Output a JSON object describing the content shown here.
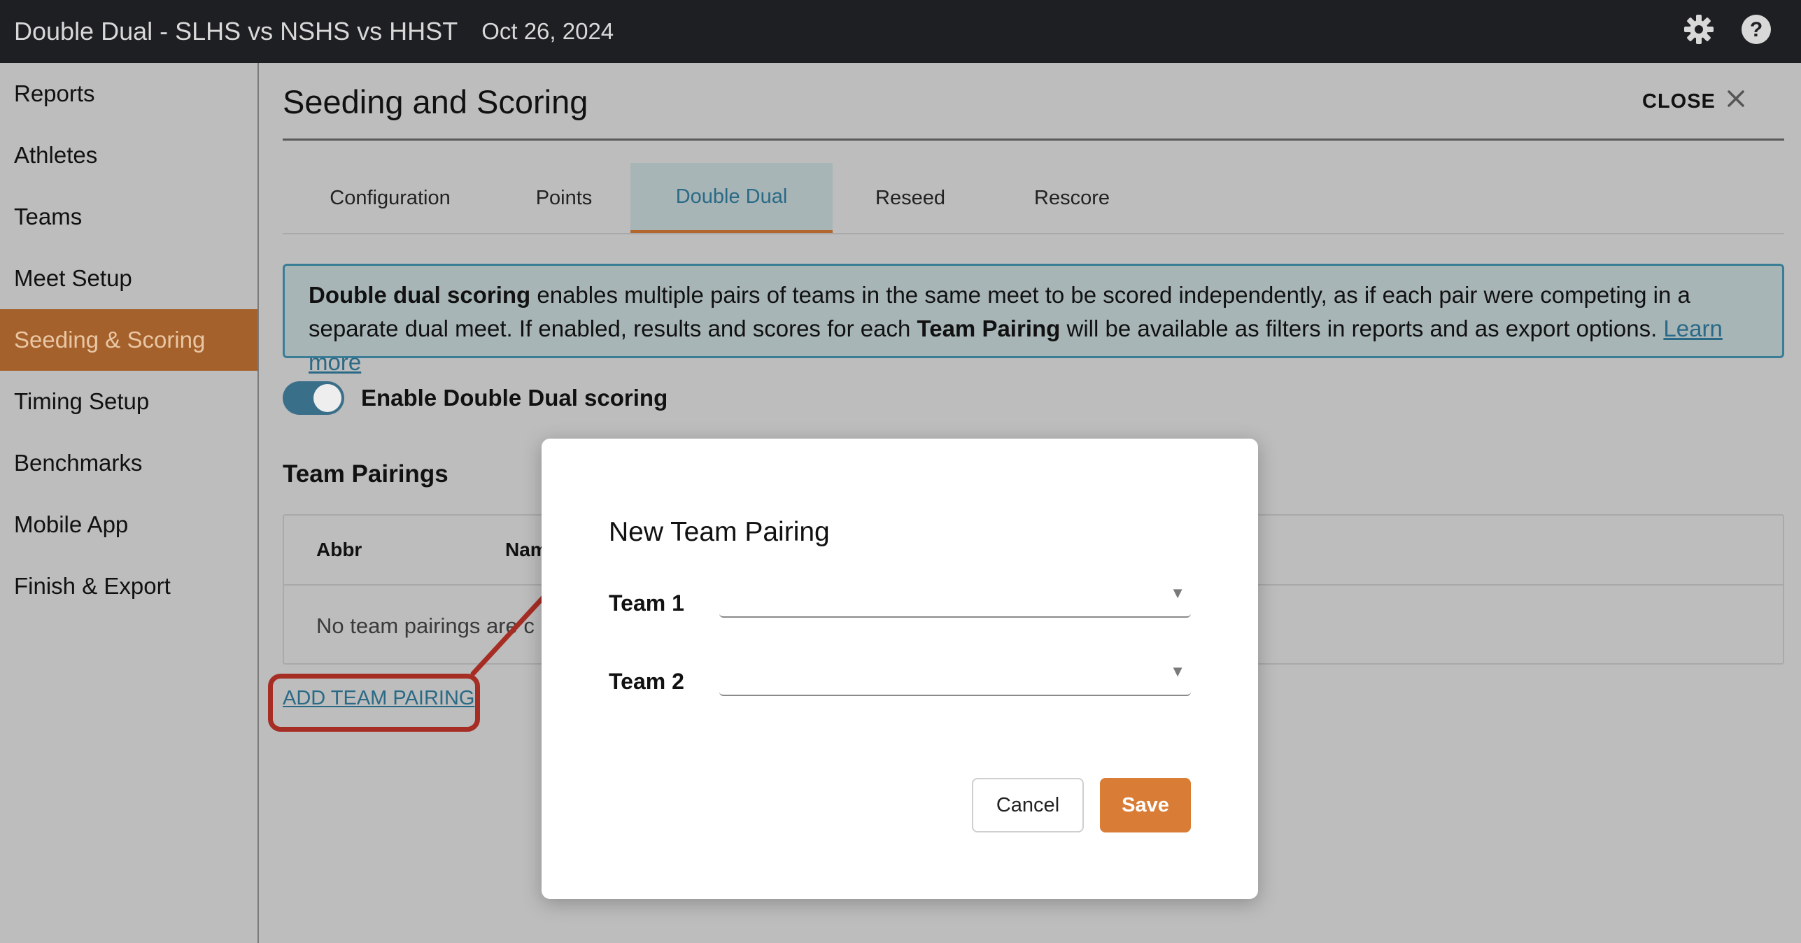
{
  "header": {
    "title": "Double Dual - SLHS vs NSHS vs HHST",
    "date": "Oct 26, 2024",
    "icons": [
      "gear-icon",
      "help-icon"
    ]
  },
  "sidebar": {
    "items": [
      {
        "label": "Reports"
      },
      {
        "label": "Athletes"
      },
      {
        "label": "Teams"
      },
      {
        "label": "Meet Setup"
      },
      {
        "label": "Seeding & Scoring",
        "active": true
      },
      {
        "label": "Timing Setup"
      },
      {
        "label": "Benchmarks"
      },
      {
        "label": "Mobile App"
      },
      {
        "label": "Finish & Export"
      }
    ]
  },
  "main": {
    "title": "Seeding and Scoring",
    "close_label": "CLOSE",
    "tabs": [
      {
        "label": "Configuration"
      },
      {
        "label": "Points"
      },
      {
        "label": "Double Dual",
        "active": true
      },
      {
        "label": "Reseed"
      },
      {
        "label": "Rescore"
      }
    ],
    "info": {
      "bold1": "Double dual scoring",
      "text1": " enables multiple pairs of teams in the same meet to be scored independently, as if each pair were competing in a separate dual meet. If enabled, results and scores for each ",
      "bold2": "Team Pairing",
      "text2": " will be available as filters in reports and as export options. ",
      "link": "Learn more"
    },
    "toggle": {
      "label": "Enable Double Dual scoring",
      "enabled": true
    },
    "section_title": "Team Pairings",
    "table": {
      "headers": [
        "Abbr",
        "Nam"
      ],
      "empty_text": "No team pairings are c"
    },
    "add_link": "ADD TEAM PAIRING"
  },
  "modal": {
    "title": "New Team Pairing",
    "team1_label": "Team 1",
    "team1_value": "",
    "team2_label": "Team 2",
    "team2_value": "",
    "cancel_label": "Cancel",
    "save_label": "Save"
  },
  "colors": {
    "topbar_bg": "#1e1f22",
    "active_nav": "#a5612b",
    "accent_blue": "#3b7d96",
    "save_orange": "#d97c35",
    "annotation_red": "#a62d24"
  }
}
